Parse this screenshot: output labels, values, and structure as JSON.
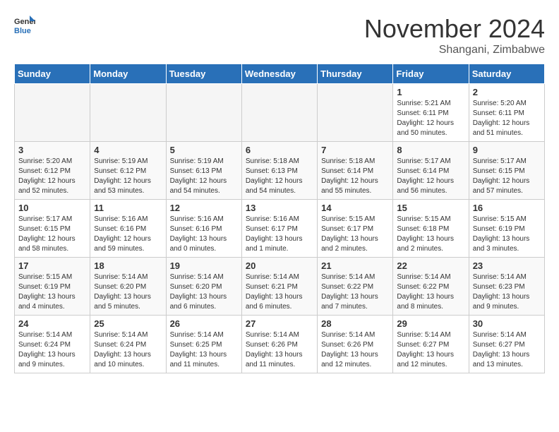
{
  "header": {
    "logo_line1": "General",
    "logo_line2": "Blue",
    "month": "November 2024",
    "location": "Shangani, Zimbabwe"
  },
  "days_of_week": [
    "Sunday",
    "Monday",
    "Tuesday",
    "Wednesday",
    "Thursday",
    "Friday",
    "Saturday"
  ],
  "weeks": [
    [
      {
        "day": "",
        "info": ""
      },
      {
        "day": "",
        "info": ""
      },
      {
        "day": "",
        "info": ""
      },
      {
        "day": "",
        "info": ""
      },
      {
        "day": "",
        "info": ""
      },
      {
        "day": "1",
        "info": "Sunrise: 5:21 AM\nSunset: 6:11 PM\nDaylight: 12 hours\nand 50 minutes."
      },
      {
        "day": "2",
        "info": "Sunrise: 5:20 AM\nSunset: 6:11 PM\nDaylight: 12 hours\nand 51 minutes."
      }
    ],
    [
      {
        "day": "3",
        "info": "Sunrise: 5:20 AM\nSunset: 6:12 PM\nDaylight: 12 hours\nand 52 minutes."
      },
      {
        "day": "4",
        "info": "Sunrise: 5:19 AM\nSunset: 6:12 PM\nDaylight: 12 hours\nand 53 minutes."
      },
      {
        "day": "5",
        "info": "Sunrise: 5:19 AM\nSunset: 6:13 PM\nDaylight: 12 hours\nand 54 minutes."
      },
      {
        "day": "6",
        "info": "Sunrise: 5:18 AM\nSunset: 6:13 PM\nDaylight: 12 hours\nand 54 minutes."
      },
      {
        "day": "7",
        "info": "Sunrise: 5:18 AM\nSunset: 6:14 PM\nDaylight: 12 hours\nand 55 minutes."
      },
      {
        "day": "8",
        "info": "Sunrise: 5:17 AM\nSunset: 6:14 PM\nDaylight: 12 hours\nand 56 minutes."
      },
      {
        "day": "9",
        "info": "Sunrise: 5:17 AM\nSunset: 6:15 PM\nDaylight: 12 hours\nand 57 minutes."
      }
    ],
    [
      {
        "day": "10",
        "info": "Sunrise: 5:17 AM\nSunset: 6:15 PM\nDaylight: 12 hours\nand 58 minutes."
      },
      {
        "day": "11",
        "info": "Sunrise: 5:16 AM\nSunset: 6:16 PM\nDaylight: 12 hours\nand 59 minutes."
      },
      {
        "day": "12",
        "info": "Sunrise: 5:16 AM\nSunset: 6:16 PM\nDaylight: 13 hours\nand 0 minutes."
      },
      {
        "day": "13",
        "info": "Sunrise: 5:16 AM\nSunset: 6:17 PM\nDaylight: 13 hours\nand 1 minute."
      },
      {
        "day": "14",
        "info": "Sunrise: 5:15 AM\nSunset: 6:17 PM\nDaylight: 13 hours\nand 2 minutes."
      },
      {
        "day": "15",
        "info": "Sunrise: 5:15 AM\nSunset: 6:18 PM\nDaylight: 13 hours\nand 2 minutes."
      },
      {
        "day": "16",
        "info": "Sunrise: 5:15 AM\nSunset: 6:19 PM\nDaylight: 13 hours\nand 3 minutes."
      }
    ],
    [
      {
        "day": "17",
        "info": "Sunrise: 5:15 AM\nSunset: 6:19 PM\nDaylight: 13 hours\nand 4 minutes."
      },
      {
        "day": "18",
        "info": "Sunrise: 5:14 AM\nSunset: 6:20 PM\nDaylight: 13 hours\nand 5 minutes."
      },
      {
        "day": "19",
        "info": "Sunrise: 5:14 AM\nSunset: 6:20 PM\nDaylight: 13 hours\nand 6 minutes."
      },
      {
        "day": "20",
        "info": "Sunrise: 5:14 AM\nSunset: 6:21 PM\nDaylight: 13 hours\nand 6 minutes."
      },
      {
        "day": "21",
        "info": "Sunrise: 5:14 AM\nSunset: 6:22 PM\nDaylight: 13 hours\nand 7 minutes."
      },
      {
        "day": "22",
        "info": "Sunrise: 5:14 AM\nSunset: 6:22 PM\nDaylight: 13 hours\nand 8 minutes."
      },
      {
        "day": "23",
        "info": "Sunrise: 5:14 AM\nSunset: 6:23 PM\nDaylight: 13 hours\nand 9 minutes."
      }
    ],
    [
      {
        "day": "24",
        "info": "Sunrise: 5:14 AM\nSunset: 6:24 PM\nDaylight: 13 hours\nand 9 minutes."
      },
      {
        "day": "25",
        "info": "Sunrise: 5:14 AM\nSunset: 6:24 PM\nDaylight: 13 hours\nand 10 minutes."
      },
      {
        "day": "26",
        "info": "Sunrise: 5:14 AM\nSunset: 6:25 PM\nDaylight: 13 hours\nand 11 minutes."
      },
      {
        "day": "27",
        "info": "Sunrise: 5:14 AM\nSunset: 6:26 PM\nDaylight: 13 hours\nand 11 minutes."
      },
      {
        "day": "28",
        "info": "Sunrise: 5:14 AM\nSunset: 6:26 PM\nDaylight: 13 hours\nand 12 minutes."
      },
      {
        "day": "29",
        "info": "Sunrise: 5:14 AM\nSunset: 6:27 PM\nDaylight: 13 hours\nand 12 minutes."
      },
      {
        "day": "30",
        "info": "Sunrise: 5:14 AM\nSunset: 6:27 PM\nDaylight: 13 hours\nand 13 minutes."
      }
    ]
  ]
}
